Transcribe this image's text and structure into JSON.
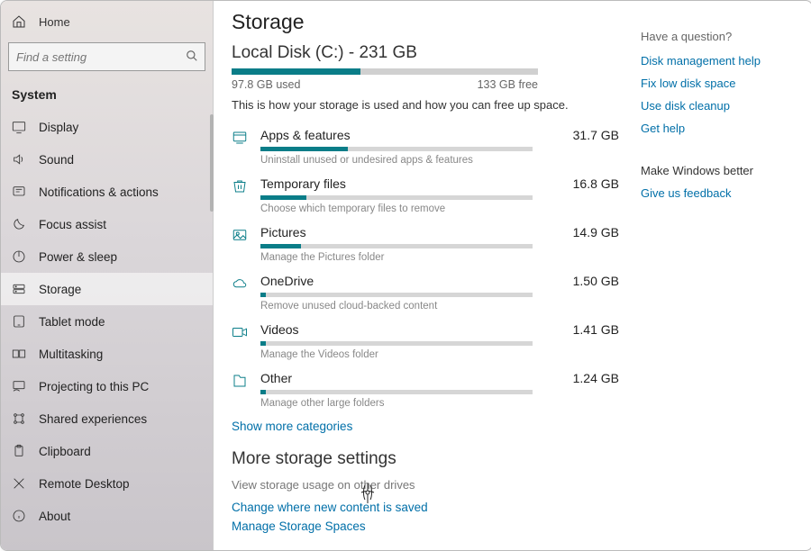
{
  "sidebar": {
    "home": "Home",
    "search_placeholder": "Find a setting",
    "section": "System",
    "items": [
      {
        "label": "Display"
      },
      {
        "label": "Sound"
      },
      {
        "label": "Notifications & actions"
      },
      {
        "label": "Focus assist"
      },
      {
        "label": "Power & sleep"
      },
      {
        "label": "Storage"
      },
      {
        "label": "Tablet mode"
      },
      {
        "label": "Multitasking"
      },
      {
        "label": "Projecting to this PC"
      },
      {
        "label": "Shared experiences"
      },
      {
        "label": "Clipboard"
      },
      {
        "label": "Remote Desktop"
      },
      {
        "label": "About"
      }
    ]
  },
  "page": {
    "title": "Storage",
    "drive_title": "Local Disk (C:) - 231 GB",
    "used_pct": 42,
    "used_text": "97.8 GB used",
    "free_text": "133 GB free",
    "desc": "This is how your storage is used and how you can free up space.",
    "show_more": "Show more categories",
    "more_title": "More storage settings",
    "more_links": {
      "view": "View storage usage on other drives",
      "change": "Change where new content is saved",
      "spaces": "Manage Storage Spaces"
    }
  },
  "categories": [
    {
      "name": "Apps & features",
      "size": "31.7 GB",
      "hint": "Uninstall unused or undesired apps & features",
      "pct": 32
    },
    {
      "name": "Temporary files",
      "size": "16.8 GB",
      "hint": "Choose which temporary files to remove",
      "pct": 17
    },
    {
      "name": "Pictures",
      "size": "14.9 GB",
      "hint": "Manage the Pictures folder",
      "pct": 15
    },
    {
      "name": "OneDrive",
      "size": "1.50 GB",
      "hint": "Remove unused cloud-backed content",
      "pct": 2
    },
    {
      "name": "Videos",
      "size": "1.41 GB",
      "hint": "Manage the Videos folder",
      "pct": 2
    },
    {
      "name": "Other",
      "size": "1.24 GB",
      "hint": "Manage other large folders",
      "pct": 2
    }
  ],
  "aside": {
    "question": "Have a question?",
    "links": [
      "Disk management help",
      "Fix low disk space",
      "Use disk cleanup",
      "Get help"
    ],
    "better": "Make Windows better",
    "feedback": "Give us feedback"
  }
}
